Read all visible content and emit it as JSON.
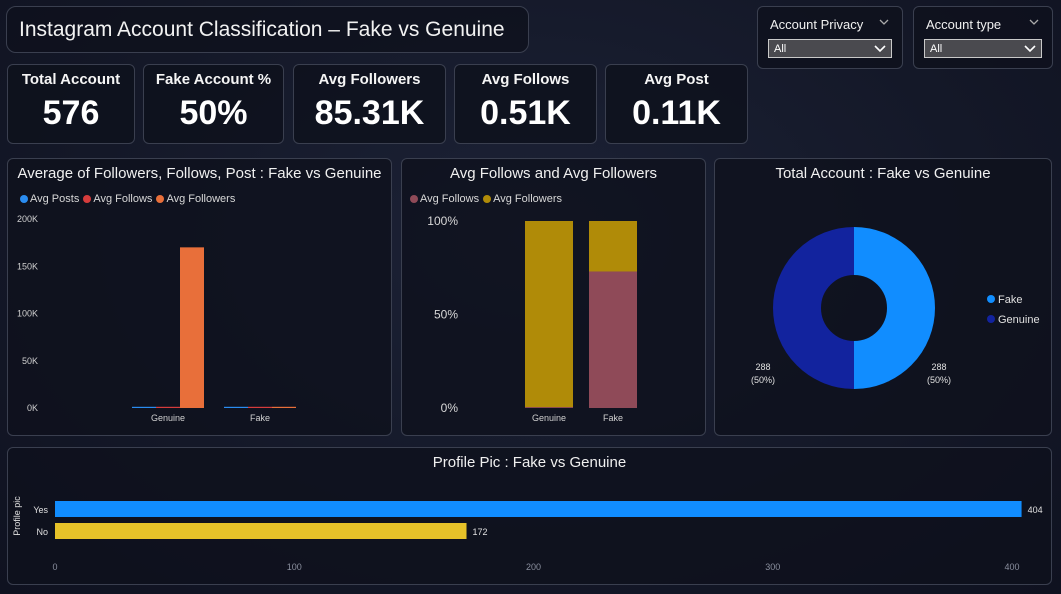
{
  "header": {
    "title": "Instagram Account Classification – Fake vs Genuine"
  },
  "filters": [
    {
      "label": "Account Privacy",
      "value": "All"
    },
    {
      "label": "Account type",
      "value": "All"
    }
  ],
  "kpis": [
    {
      "label": "Total Account",
      "value": "576"
    },
    {
      "label": "Fake Account %",
      "value": "50%"
    },
    {
      "label": "Avg Followers",
      "value": "85.31K"
    },
    {
      "label": "Avg Follows",
      "value": "0.51K"
    },
    {
      "label": "Avg Post",
      "value": "0.11K"
    }
  ],
  "colors": {
    "posts": "#2a8cf0",
    "follows_red": "#d63c3c",
    "followers_orange": "#e86f3a",
    "follows_mauve": "#8f4a58",
    "followers_gold": "#b08b08",
    "fake_blue": "#118dff",
    "genuine_blue": "#12239e",
    "yes_bar": "#118dff",
    "no_bar": "#e6c229"
  },
  "chart_data": [
    {
      "type": "bar",
      "title": "Average of Followers, Follows, Post : Fake vs Genuine",
      "categories": [
        "Genuine",
        "Fake"
      ],
      "series": [
        {
          "name": "Avg Posts",
          "values": [
            260,
            20
          ]
        },
        {
          "name": "Avg Follows",
          "values": [
            800,
            220
          ]
        },
        {
          "name": "Avg Followers",
          "values": [
            170000,
            400
          ]
        }
      ],
      "yticks": [
        "0K",
        "50K",
        "100K",
        "150K",
        "200K"
      ],
      "ylim": [
        0,
        200000
      ],
      "legend": "top-left"
    },
    {
      "type": "bar",
      "title": "Avg Follows and Avg Followers",
      "stacked_percent": true,
      "categories": [
        "Genuine",
        "Fake"
      ],
      "series": [
        {
          "name": "Avg Follows",
          "values": [
            0.5,
            73
          ]
        },
        {
          "name": "Avg Followers",
          "values": [
            99.5,
            27
          ]
        }
      ],
      "yticks": [
        "0%",
        "50%",
        "100%"
      ],
      "ylim": [
        0,
        100
      ],
      "legend": "top-left"
    },
    {
      "type": "pie",
      "title": "Total Account : Fake vs Genuine",
      "labels": [
        "Fake",
        "Genuine"
      ],
      "values": [
        288,
        288
      ],
      "data_labels": [
        {
          "line1": "288",
          "line2": "(50%)"
        },
        {
          "line1": "288",
          "line2": "(50%)"
        }
      ],
      "legend": "right"
    },
    {
      "type": "bar",
      "orientation": "horizontal",
      "title": "Profile Pic : Fake vs Genuine",
      "ylabel": "Profile pic",
      "categories": [
        "Yes",
        "No"
      ],
      "values": [
        404,
        172
      ],
      "value_labels": [
        "404",
        "172"
      ],
      "xticks": [
        "0",
        "100",
        "200",
        "300",
        "400"
      ],
      "xlim": [
        0,
        400
      ]
    }
  ]
}
